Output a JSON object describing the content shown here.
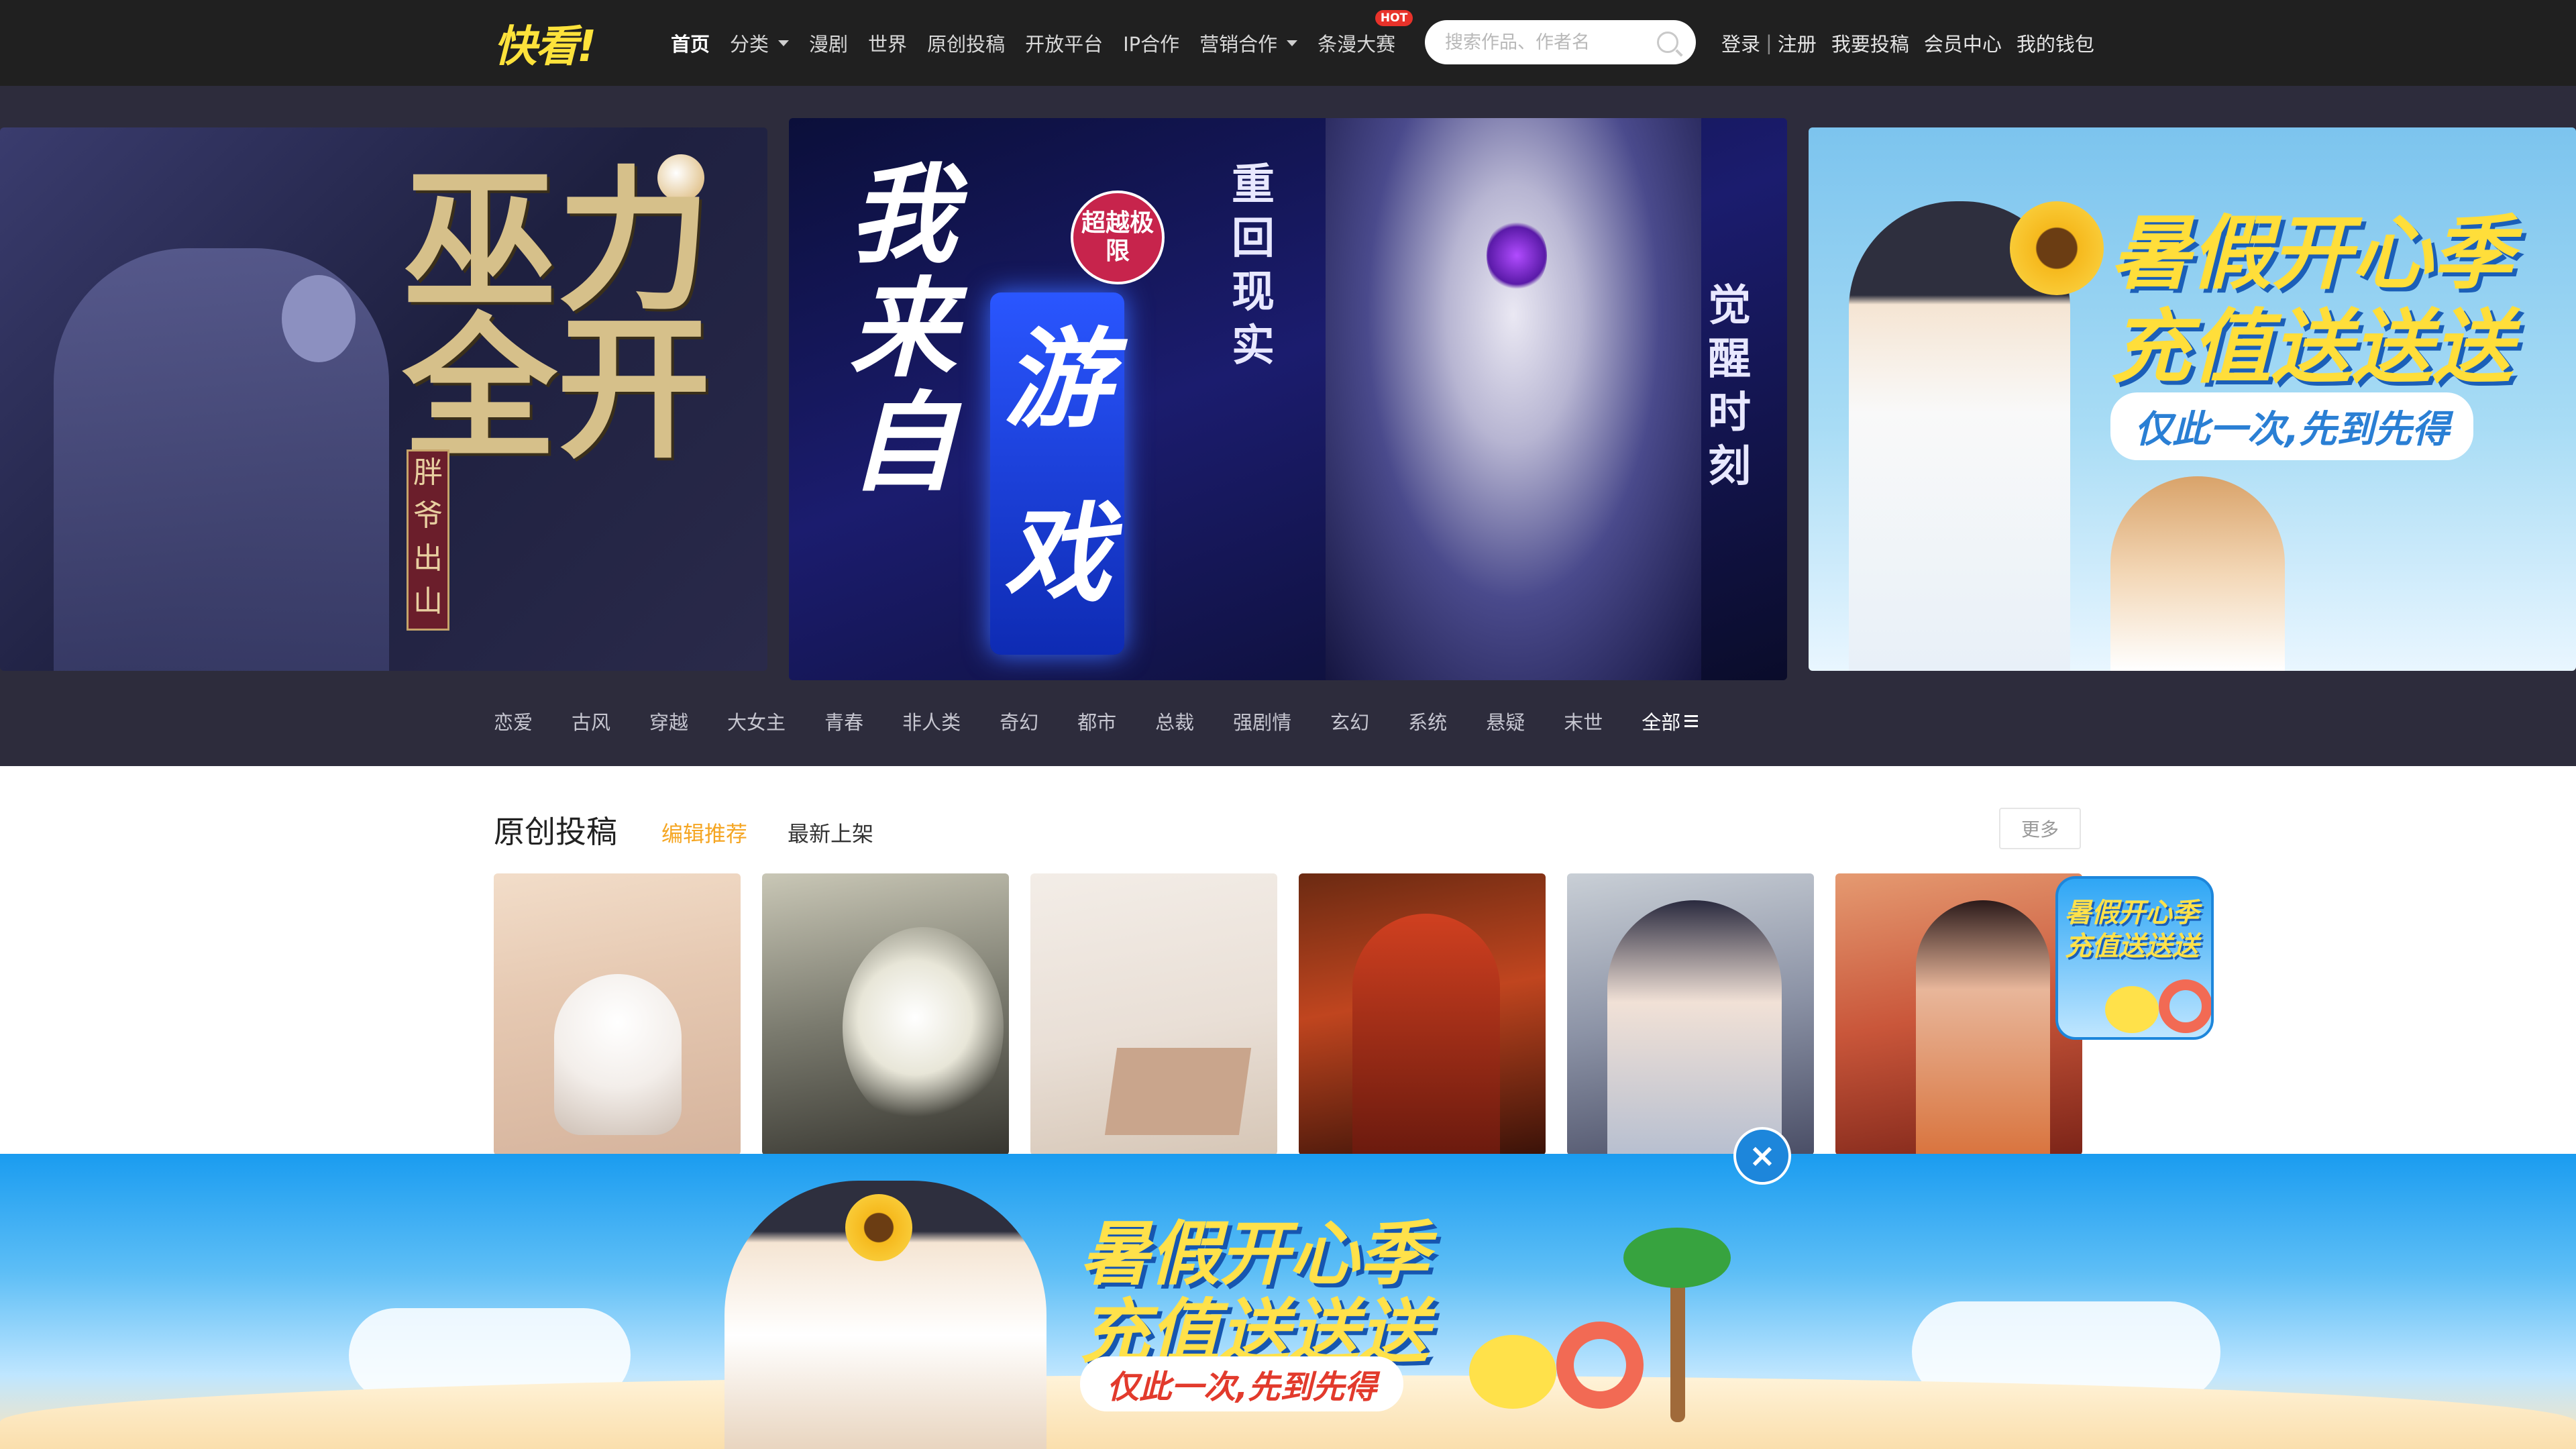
{
  "header": {
    "logo_text": "快看!",
    "nav": [
      {
        "label": "首页",
        "active": true
      },
      {
        "label": "分类",
        "has_dropdown": true
      },
      {
        "label": "漫剧"
      },
      {
        "label": "世界"
      },
      {
        "label": "原创投稿"
      },
      {
        "label": "开放平台"
      },
      {
        "label": "IP合作"
      },
      {
        "label": "营销合作",
        "has_dropdown": true
      },
      {
        "label": "条漫大赛",
        "badge": "HOT"
      }
    ],
    "search": {
      "placeholder": "搜索作品、作者名"
    },
    "auth": {
      "login": "登录",
      "separator": "|",
      "register": "注册"
    },
    "links": [
      "我要投稿",
      "会员中心",
      "我的钱包"
    ]
  },
  "banners": {
    "left": {
      "title": "巫力全开",
      "seal": "胖爷出山"
    },
    "center": {
      "title_a": "我来自",
      "title_b": "游戏",
      "badge": "超越极限",
      "vertical_1": "重回现实",
      "vertical_2": "觉醒时刻"
    },
    "right": {
      "title_1": "暑假开心季",
      "title_2": "充值送送送",
      "subtitle": "仅此一次,先到先得"
    }
  },
  "categories": [
    "恋爱",
    "古风",
    "穿越",
    "大女主",
    "青春",
    "非人类",
    "奇幻",
    "都市",
    "总裁",
    "强剧情",
    "玄幻",
    "系统",
    "悬疑",
    "末世"
  ],
  "category_all": "全部",
  "original_section": {
    "title": "原创投稿",
    "tabs": [
      {
        "label": "编辑推荐",
        "active": true
      },
      {
        "label": "最新上架",
        "active": false
      }
    ],
    "more": "更多"
  },
  "float_promo": {
    "title": "暑假开心季充值送送送"
  },
  "bottom_promo": {
    "title_1": "暑假开心季",
    "title_2": "充值送送送",
    "subtitle": "仅此一次,先到先得",
    "close": "×"
  },
  "colors": {
    "header_bg": "#202020",
    "banner_bg": "#2d2c3c",
    "accent": "#f5a623",
    "logo": "#fde23b",
    "hot": "#e8322a"
  }
}
